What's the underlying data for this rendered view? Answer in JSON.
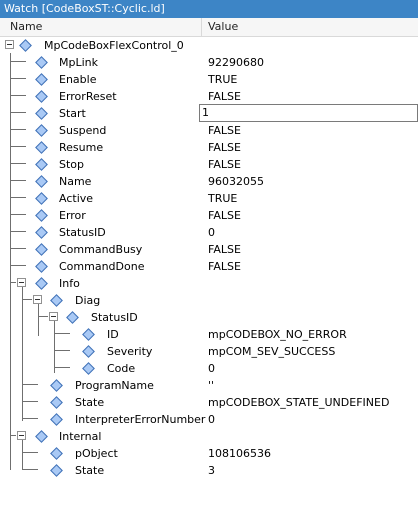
{
  "window": {
    "title": "Watch [CodeBoxST::Cyclic.ld]"
  },
  "columns": {
    "name": "Name",
    "value": "Value"
  },
  "rows": [
    {
      "label": "MpCodeBoxFlexControl_0",
      "value": ""
    },
    {
      "label": "MpLink",
      "value": "92290680"
    },
    {
      "label": "Enable",
      "value": "TRUE"
    },
    {
      "label": "ErrorReset",
      "value": "FALSE"
    },
    {
      "label": "Start",
      "value": "1"
    },
    {
      "label": "Suspend",
      "value": "FALSE"
    },
    {
      "label": "Resume",
      "value": "FALSE"
    },
    {
      "label": "Stop",
      "value": "FALSE"
    },
    {
      "label": "Name",
      "value": "96032055"
    },
    {
      "label": "Active",
      "value": "TRUE"
    },
    {
      "label": "Error",
      "value": "FALSE"
    },
    {
      "label": "StatusID",
      "value": "0"
    },
    {
      "label": "CommandBusy",
      "value": "FALSE"
    },
    {
      "label": "CommandDone",
      "value": "FALSE"
    },
    {
      "label": "Info",
      "value": ""
    },
    {
      "label": "Diag",
      "value": ""
    },
    {
      "label": "StatusID",
      "value": ""
    },
    {
      "label": "ID",
      "value": "mpCODEBOX_NO_ERROR"
    },
    {
      "label": "Severity",
      "value": "mpCOM_SEV_SUCCESS"
    },
    {
      "label": "Code",
      "value": "0"
    },
    {
      "label": "ProgramName",
      "value": "''"
    },
    {
      "label": "State",
      "value": "mpCODEBOX_STATE_UNDEFINED"
    },
    {
      "label": "InterpreterErrorNumber",
      "value": "0"
    },
    {
      "label": "Internal",
      "value": ""
    },
    {
      "label": "pObject",
      "value": "108106536"
    },
    {
      "label": "State",
      "value": "3"
    }
  ],
  "icons": {
    "variable": "diamond-icon",
    "expanded": "collapse-toggle-icon"
  },
  "colors": {
    "title_bar": "#3d85c6",
    "diamond_fill": "#a9c9f5",
    "diamond_border": "#3d6fb5"
  }
}
